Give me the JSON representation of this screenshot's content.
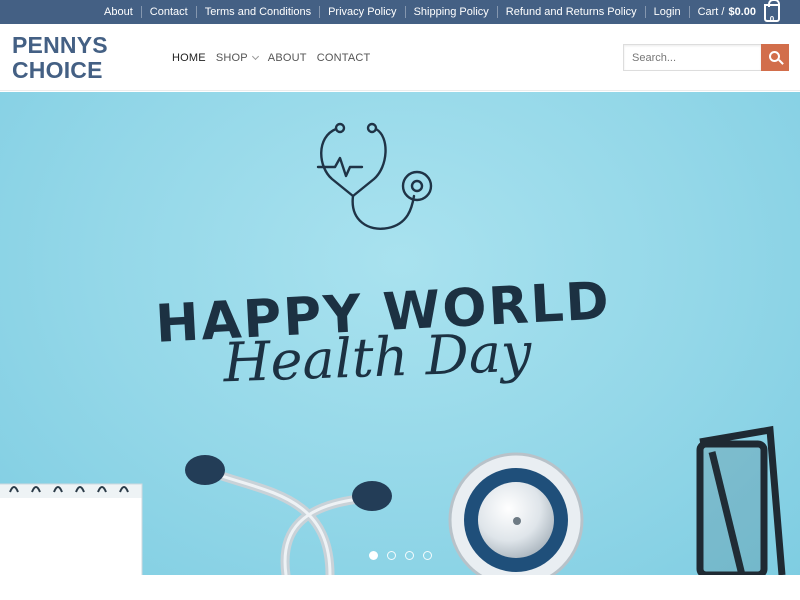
{
  "topbar": {
    "links": [
      "About",
      "Contact",
      "Terms and Conditions",
      "Privacy Policy",
      "Shipping Policy",
      "Refund and Returns Policy",
      "Login"
    ],
    "cart_label": "Cart /",
    "cart_total": "$0.00",
    "cart_count": "0",
    "bg_color": "#446084"
  },
  "header": {
    "logo_line1": "PENNYS",
    "logo_line2": "CHOICE",
    "nav": [
      "HOME",
      "SHOP",
      "ABOUT",
      "CONTACT"
    ],
    "search_placeholder": "Search...",
    "search_button_color": "#d26e4b"
  },
  "hero": {
    "headline": "HAPPY WORLD",
    "script_text": "Health Day",
    "slides": 4,
    "active_slide": 1,
    "icons": [
      "stethoscope-icon",
      "notepad",
      "eyeglasses"
    ]
  }
}
